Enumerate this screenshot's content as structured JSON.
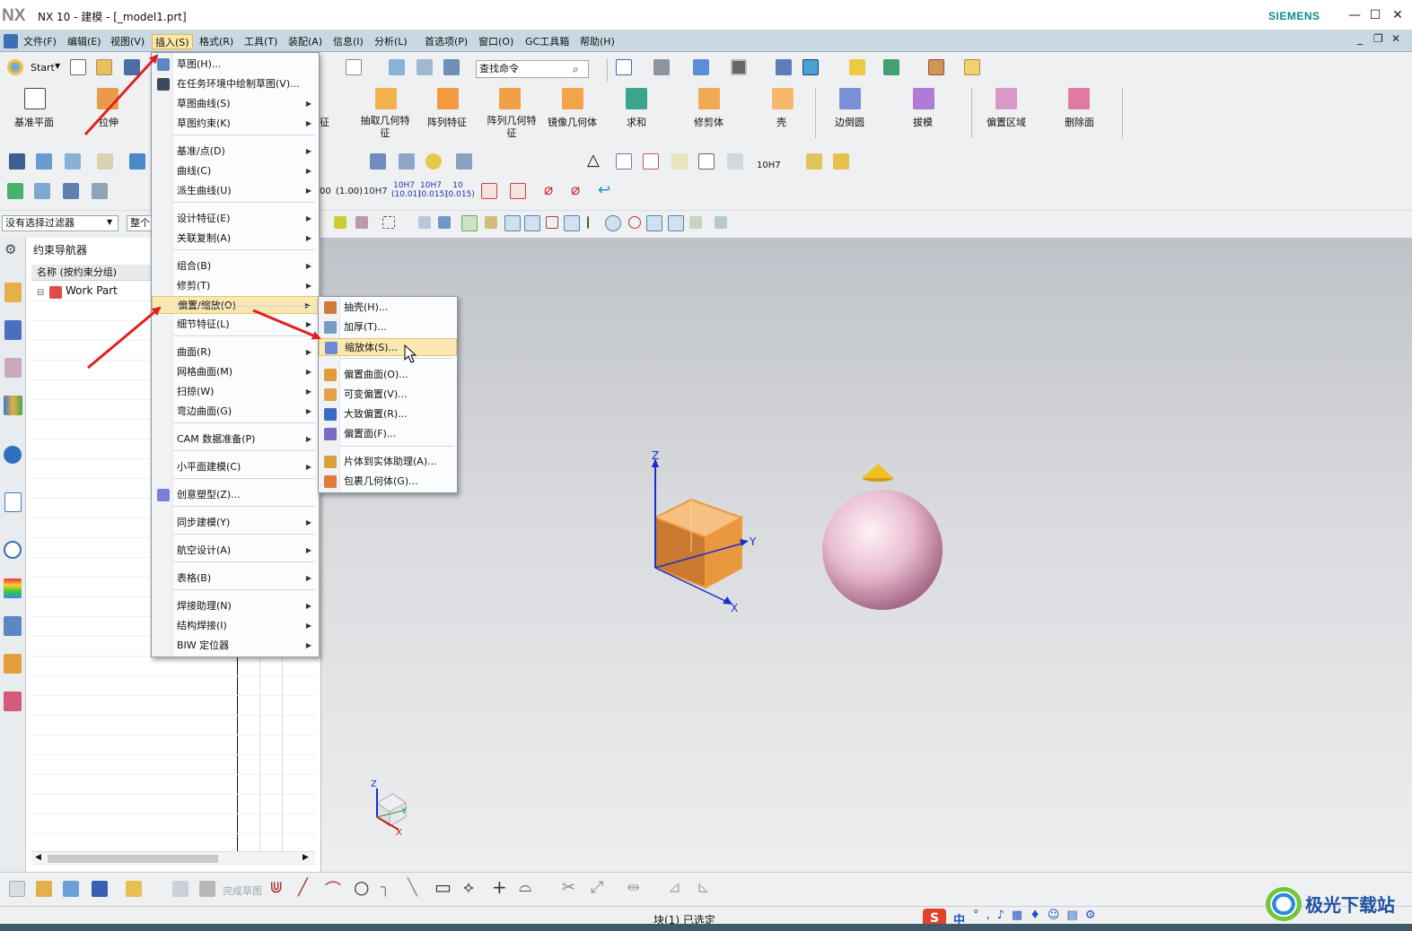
{
  "titlebar": {
    "logo": "NX",
    "title": "NX 10 - 建模 - [_model1.prt]",
    "brand": "SIEMENS"
  },
  "menubar": {
    "items": [
      "文件(F)",
      "编辑(E)",
      "视图(V)",
      "插入(S)",
      "格式(R)",
      "工具(T)",
      "装配(A)",
      "信息(I)",
      "分析(L)",
      "首选项(P)",
      "窗口(O)",
      "GC工具箱",
      "帮助(H)"
    ]
  },
  "toolbar": {
    "start_label": "Start",
    "search_placeholder": "查找命令",
    "features": [
      "基准平面",
      "拉伸",
      "抽取几何特征",
      "阵列特征",
      "阵列几何特征",
      "镜像几何体",
      "求和",
      "修剪体",
      "壳",
      "边倒圆",
      "拔模",
      "偏置区域",
      "删除面"
    ],
    "partial_label": "征",
    "dim_labels": [
      "00",
      "(1.00)",
      "10H7",
      "10H7 (10.01)",
      "10H7 (0.015)",
      "10 (0.015)"
    ],
    "tol_label": "10H7",
    "filter_value": "没有选择过滤器",
    "scope_value": "整个"
  },
  "navigator": {
    "title": "约束导航器",
    "column_header": "名称 (按约束分组)",
    "root_item": "Work Part"
  },
  "insert_menu": {
    "items": [
      {
        "label": "草图(H)...",
        "sub": false
      },
      {
        "label": "在任务环境中绘制草图(V)...",
        "sub": false
      },
      {
        "label": "草图曲线(S)",
        "sub": true
      },
      {
        "label": "草图约束(K)",
        "sub": true
      },
      {
        "label": "基准/点(D)",
        "sub": true
      },
      {
        "label": "曲线(C)",
        "sub": true
      },
      {
        "label": "派生曲线(U)",
        "sub": true
      },
      {
        "label": "设计特征(E)",
        "sub": true
      },
      {
        "label": "关联复制(A)",
        "sub": true
      },
      {
        "label": "组合(B)",
        "sub": true
      },
      {
        "label": "修剪(T)",
        "sub": true
      },
      {
        "label": "偏置/缩放(O)",
        "sub": true
      },
      {
        "label": "细节特征(L)",
        "sub": true
      },
      {
        "label": "曲面(R)",
        "sub": true
      },
      {
        "label": "网格曲面(M)",
        "sub": true
      },
      {
        "label": "扫掠(W)",
        "sub": true
      },
      {
        "label": "弯边曲面(G)",
        "sub": true
      },
      {
        "label": "CAM 数据准备(P)",
        "sub": true
      },
      {
        "label": "小平面建模(C)",
        "sub": true
      },
      {
        "label": "创意塑型(Z)...",
        "sub": false
      },
      {
        "label": "同步建模(Y)",
        "sub": true
      },
      {
        "label": "航空设计(A)",
        "sub": true
      },
      {
        "label": "表格(B)",
        "sub": true
      },
      {
        "label": "焊接助理(N)",
        "sub": true
      },
      {
        "label": "结构焊接(I)",
        "sub": true
      },
      {
        "label": "BIW 定位器",
        "sub": true
      }
    ]
  },
  "offset_submenu": {
    "items": [
      "抽壳(H)...",
      "加厚(T)...",
      "缩放体(S)...",
      "偏置曲面(O)...",
      "可变偏置(V)...",
      "大致偏置(R)...",
      "偏置面(F)...",
      "片体到实体助理(A)...",
      "包裹几何体(G)..."
    ]
  },
  "viewport": {
    "axis_labels": {
      "x": "X",
      "y": "Y",
      "z": "Z"
    },
    "colors": {
      "cube": "#f0a048",
      "sphere": "#e8bcd0",
      "cone": "#f0c020",
      "axis": "#1a2fd0"
    }
  },
  "bottom_toolbar": {
    "finish_sketch": "完成草图"
  },
  "status": {
    "text": "块(1) 已选定"
  },
  "watermark": {
    "text": "极光下载站"
  },
  "tray": {
    "ime": "中"
  }
}
